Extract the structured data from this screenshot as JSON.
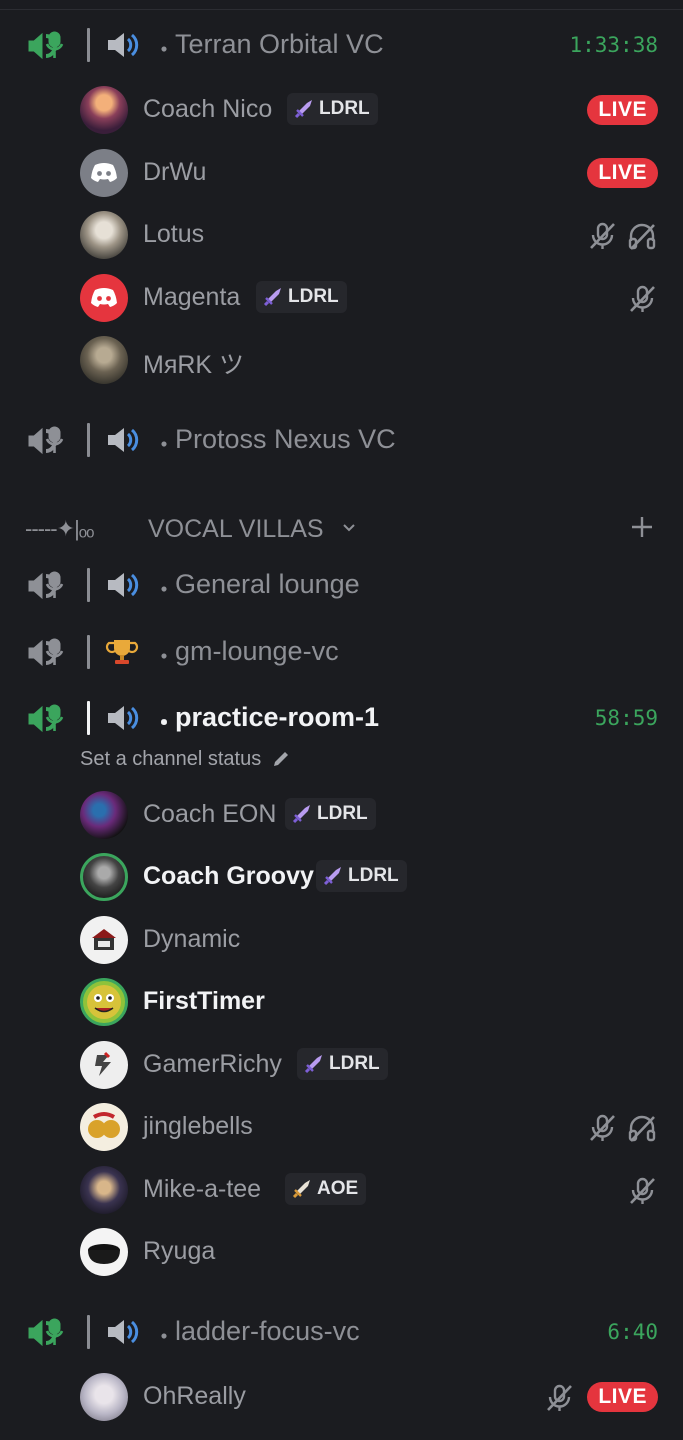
{
  "colors": {
    "background": "#1b1c20",
    "live": "#e5353e",
    "timer": "#3ba55d",
    "badge_bg": "#26272c"
  },
  "channels": [
    {
      "name": "Terran Orbital VC",
      "dot": "・",
      "timer": "1:33:38",
      "signal_icon": "voice-active-icon",
      "type_icon": "speaker-icon"
    },
    {
      "name": "Protoss Nexus VC",
      "dot": "・",
      "timer": "",
      "signal_icon": "voice-inactive-icon",
      "type_icon": "speaker-icon"
    },
    {
      "name": "General lounge",
      "dot": "・",
      "timer": "",
      "signal_icon": "voice-inactive-icon",
      "type_icon": "speaker-icon"
    },
    {
      "name": "gm-lounge-vc",
      "dot": "・",
      "timer": "",
      "signal_icon": "voice-inactive-icon",
      "type_icon": "trophy-icon"
    },
    {
      "name": "practice-room-1",
      "dot": "・",
      "timer": "58:59",
      "signal_icon": "voice-active-icon",
      "type_icon": "speaker-icon"
    },
    {
      "name": "ladder-focus-vc",
      "dot": "・",
      "timer": "6:40",
      "signal_icon": "voice-active-icon",
      "type_icon": "speaker-icon"
    }
  ],
  "category": {
    "decoration": "-----✦|ₒₒ",
    "name": "VOCAL VILLAS"
  },
  "channel_status": {
    "placeholder": "Set a channel status"
  },
  "users": [
    {
      "name": "Coach Nico",
      "badge": "LDRL",
      "live": "LIVE"
    },
    {
      "name": "DrWu",
      "live": "LIVE"
    },
    {
      "name": "Lotus"
    },
    {
      "name": "Magenta",
      "badge": "LDRL"
    },
    {
      "name": "MᴙRK ツ"
    },
    {
      "name": "Coach EON",
      "badge": "LDRL"
    },
    {
      "name": "Coach Groovy",
      "badge": "LDRL"
    },
    {
      "name": "Dynamic"
    },
    {
      "name": "FirstTimer"
    },
    {
      "name": "GamerRichy",
      "badge": "LDRL"
    },
    {
      "name": "jinglebells"
    },
    {
      "name": "Mike-a-tee",
      "badge": "AOE"
    },
    {
      "name": "Ryuga"
    },
    {
      "name": "OhReally",
      "live": "LIVE"
    }
  ]
}
